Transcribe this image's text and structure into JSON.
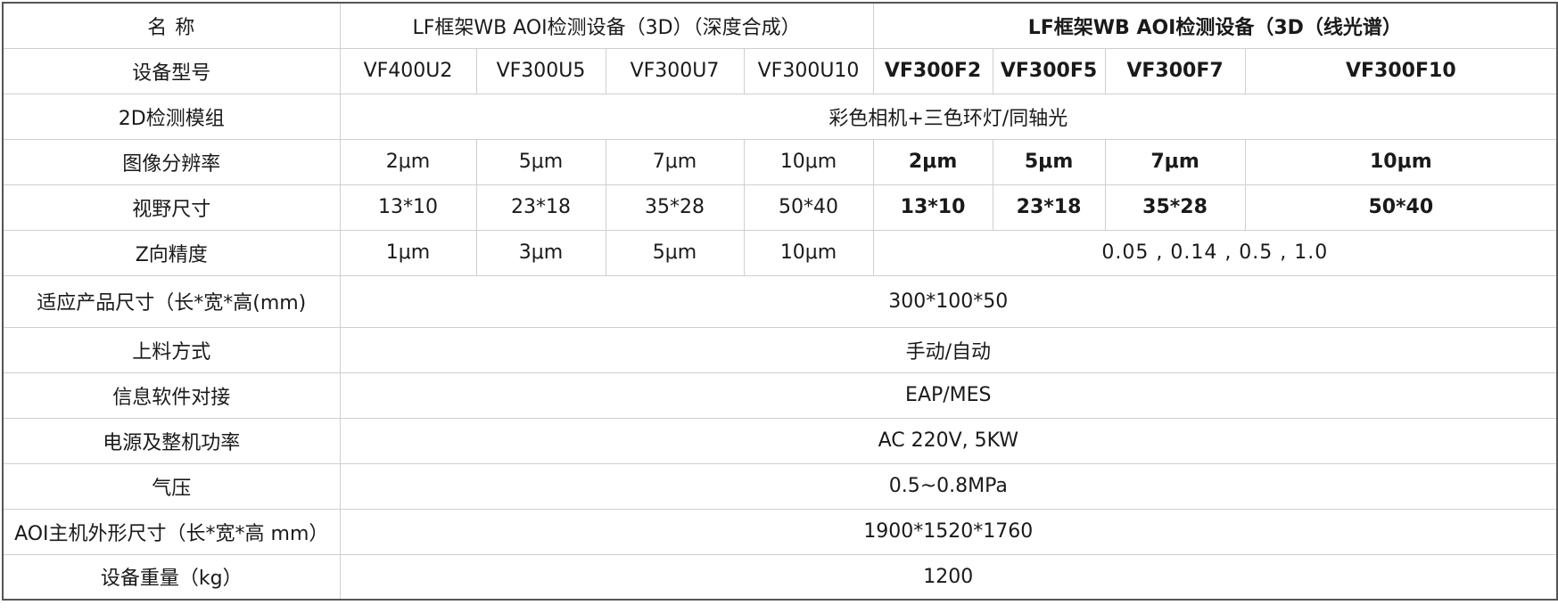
{
  "table": {
    "header": {
      "label": "名 称",
      "group_depth": "LF框架WB AOI检测设备（3D）（深度合成）",
      "group_line": "LF框架WB AOI检测设备（3D（线光谱）"
    },
    "model_row": {
      "label": "设备型号",
      "models": [
        "VF400U2",
        "VF300U5",
        "VF300U7",
        "VF300U10",
        "VF300F2",
        "VF300F5",
        "VF300F7",
        "VF300F10"
      ]
    },
    "module_row": {
      "label": "2D检测模组",
      "value": "彩色相机+三色环灯/同轴光"
    },
    "resolution_row": {
      "label": "图像分辨率",
      "values": [
        "2μm",
        "5μm",
        "7μm",
        "10μm",
        "2μm",
        "5μm",
        "7μm",
        "10μm"
      ]
    },
    "fov_row": {
      "label": "视野尺寸",
      "values": [
        "13*10",
        "23*18",
        "35*28",
        "50*40",
        "13*10",
        "23*18",
        "35*28",
        "50*40"
      ]
    },
    "z_row": {
      "label": "Z向精度",
      "values": [
        "1μm",
        "3μm",
        "5μm",
        "10μm"
      ],
      "line_value": "0.05 , 0.14 , 0.5 , 1.0"
    },
    "product_size_row": {
      "label": "适应产品尺寸（长*宽*高(mm)",
      "value": "300*100*50"
    },
    "loading_row": {
      "label": "上料方式",
      "value": "手动/自动"
    },
    "software_row": {
      "label": "信息软件对接",
      "value": "EAP/MES"
    },
    "power_row": {
      "label": "电源及整机功率",
      "value": "AC 220V, 5KW"
    },
    "pressure_row": {
      "label": "气压",
      "value": "0.5~0.8MPa"
    },
    "host_size_row": {
      "label": "AOI主机外形尺寸（长*宽*高 mm）",
      "value": "1900*1520*1760"
    },
    "weight_row": {
      "label": "设备重量（kg）",
      "value": "1200"
    }
  }
}
